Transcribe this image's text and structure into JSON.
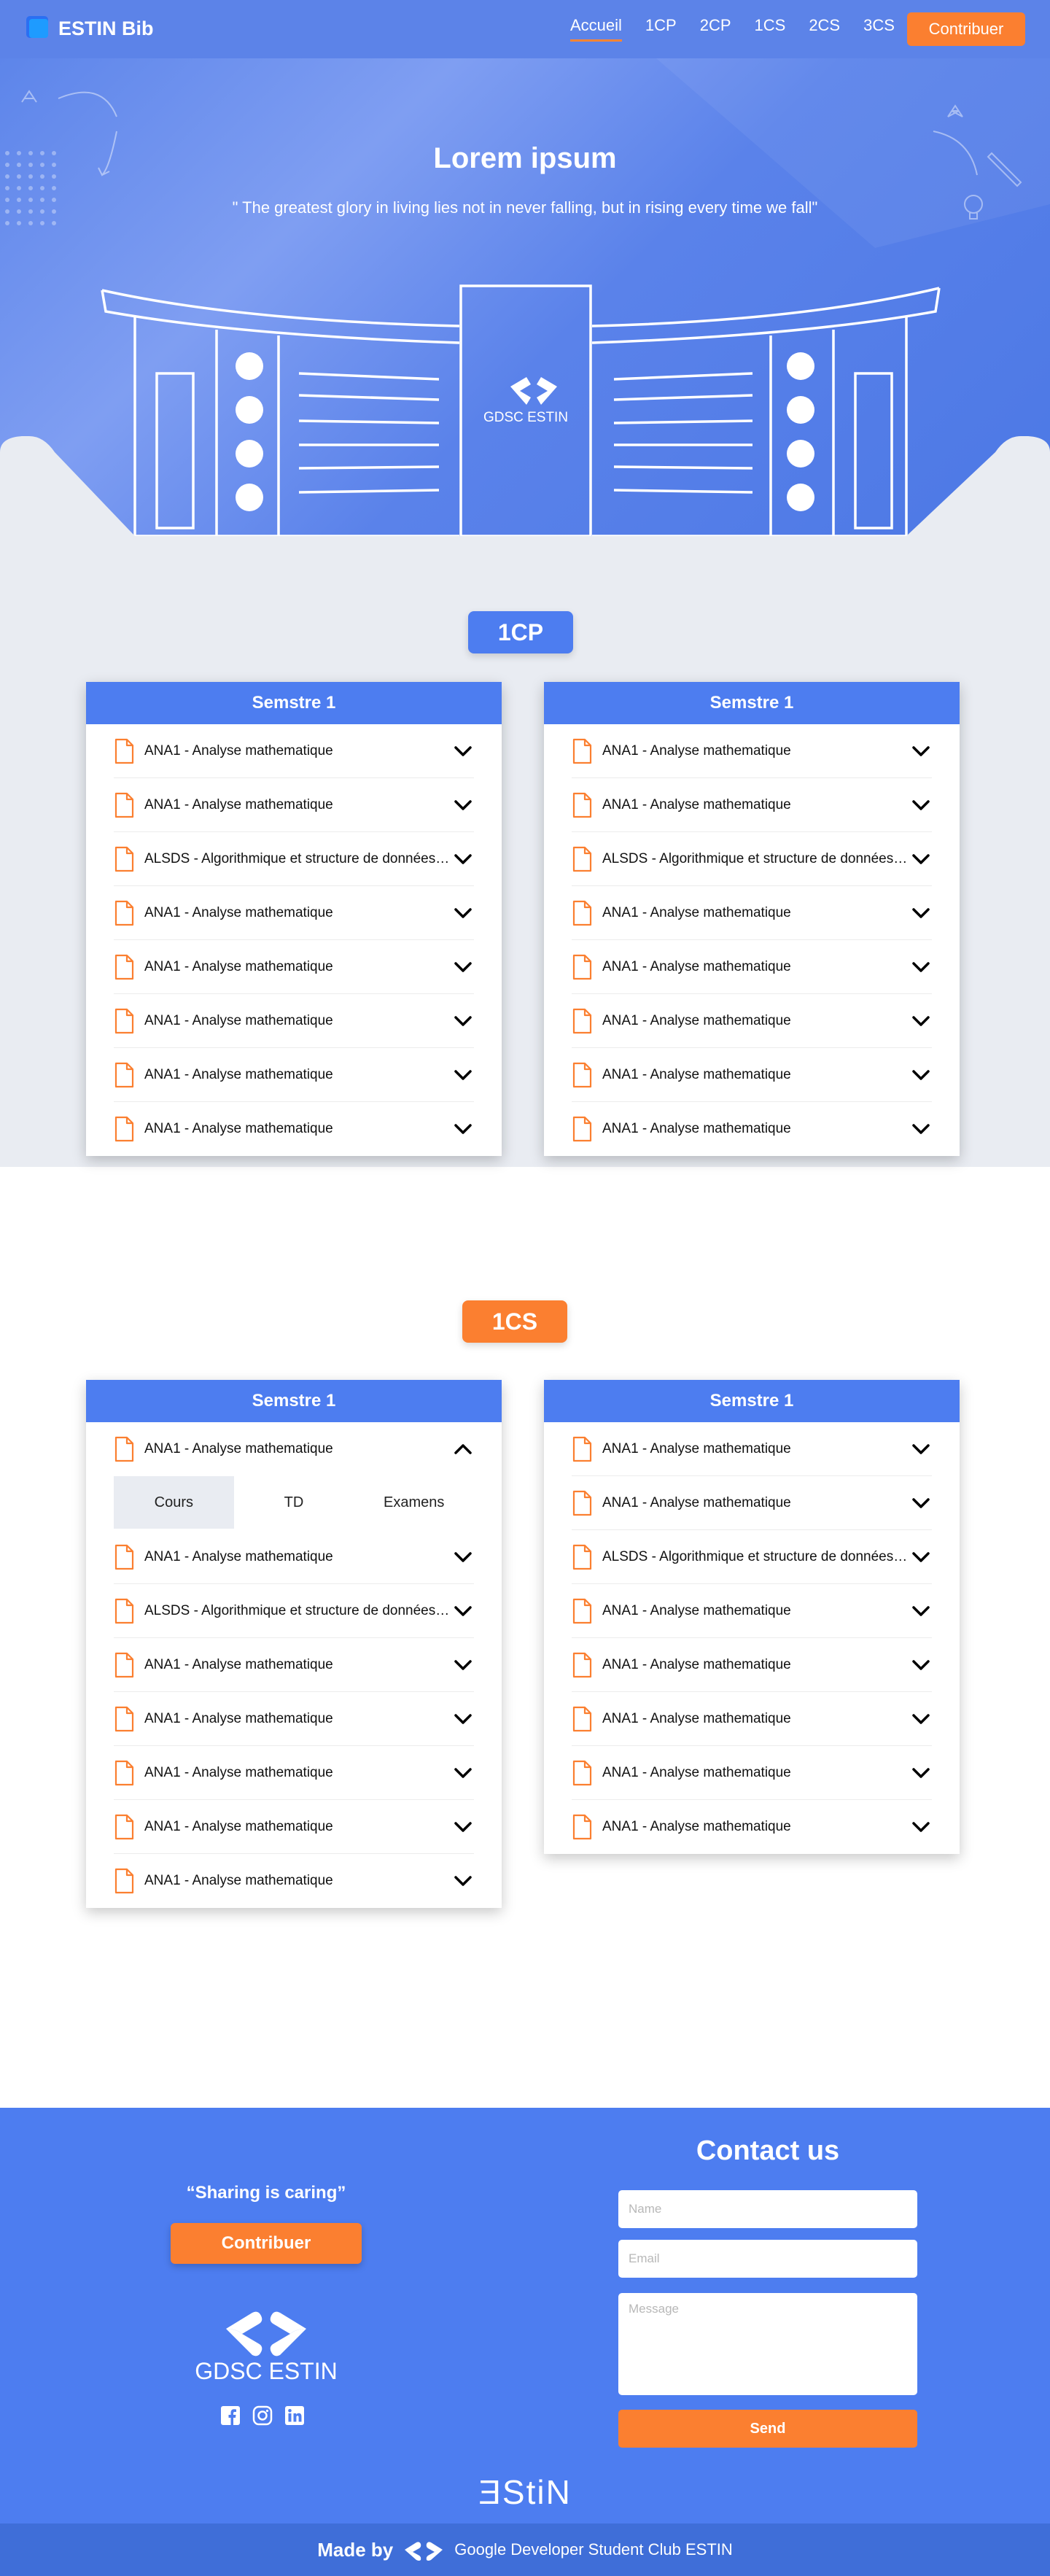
{
  "nav": {
    "brand": "ESTIN Bib",
    "links": [
      "Accueil",
      "1CP",
      "2CP",
      "1CS",
      "2CS",
      "3CS"
    ],
    "cta": "Contribuer"
  },
  "hero": {
    "title": "Lorem ipsum",
    "quote": "\" The greatest glory in living lies not in never falling, but in rising every time we fall\"",
    "building_label": "GDSC ESTIN"
  },
  "sections": [
    {
      "badge": "1CP",
      "cards": [
        {
          "header": "Semstre 1",
          "items": [
            "ANA1 - Analyse mathematique",
            "ANA1 - Analyse mathematique",
            "ALSDS - Algorithmique et structure de données statiques",
            "ANA1 - Analyse mathematique",
            "ANA1 - Analyse mathematique",
            "ANA1 - Analyse mathematique",
            "ANA1 - Analyse mathematique",
            "ANA1 - Analyse mathematique"
          ]
        },
        {
          "header": "Semstre 1",
          "items": [
            "ANA1 - Analyse mathematique",
            "ANA1 - Analyse mathematique",
            "ALSDS - Algorithmique et structure de données statiques",
            "ANA1 - Analyse mathematique",
            "ANA1 - Analyse mathematique",
            "ANA1 - Analyse mathematique",
            "ANA1 - Analyse mathematique",
            "ANA1 - Analyse mathematique"
          ]
        }
      ]
    },
    {
      "badge": "1CS",
      "cards": [
        {
          "header": "Semstre 1",
          "expanded_item": "ANA1 - Analyse mathematique",
          "subtabs": [
            "Cours",
            "TD",
            "Examens"
          ],
          "items": [
            "ANA1 - Analyse mathematique",
            "ALSDS - Algorithmique et structure de données statiques",
            "ANA1 - Analyse mathematique",
            "ANA1 - Analyse mathematique",
            "ANA1 - Analyse mathematique",
            "ANA1 - Analyse mathematique",
            "ANA1 - Analyse mathematique"
          ]
        },
        {
          "header": "Semstre 1",
          "items": [
            "ANA1 - Analyse mathematique",
            "ANA1 - Analyse mathematique",
            "ALSDS - Algorithmique et structure de données statiques",
            "ANA1 - Analyse mathematique",
            "ANA1 - Analyse mathematique",
            "ANA1 - Analyse mathematique",
            "ANA1 - Analyse mathematique",
            "ANA1 - Analyse mathematique"
          ]
        }
      ]
    }
  ],
  "footer": {
    "quote": "“Sharing is caring”",
    "cta": "Contribuer",
    "gdsc_text": "GDSC ESTIN",
    "contact_title": "Contact us",
    "name_placeholder": "Name",
    "email_placeholder": "Email",
    "message_placeholder": "Message",
    "send": "Send",
    "estin_word": "ƎStiN",
    "made_by": "Made by",
    "club_name": "Google Developer Student Club ESTIN",
    "socials": [
      "facebook-icon",
      "instagram-icon",
      "linkedin-icon"
    ]
  },
  "colors": {
    "primary": "#4d7df0",
    "accent": "#fb7f30",
    "section_bg": "#e9ecf2"
  }
}
